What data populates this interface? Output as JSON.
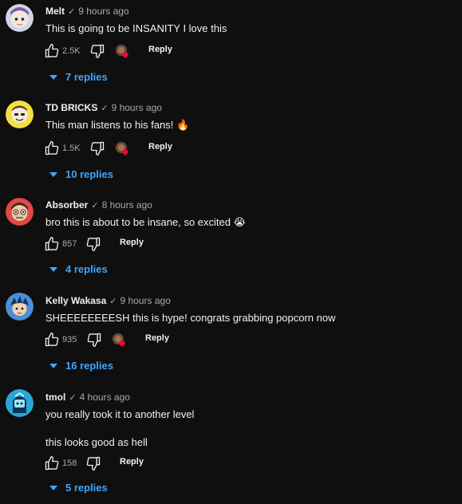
{
  "comments": [
    {
      "author": "Melt",
      "time": "9 hours ago",
      "text": [
        "This is going to be INSANITY I love this"
      ],
      "likes": "2.5K",
      "reply": "Reply",
      "replies": "7 replies",
      "creator_heart": true
    },
    {
      "author": "TD BRICKS",
      "time": "9 hours ago",
      "text": [
        "This man listens to his fans! 🔥"
      ],
      "likes": "1.5K",
      "reply": "Reply",
      "replies": "10 replies",
      "creator_heart": true
    },
    {
      "author": "Absorber",
      "time": "8 hours ago",
      "text": [
        "bro this is about to be insane, so excited 😭"
      ],
      "likes": "857",
      "reply": "Reply",
      "replies": "4 replies",
      "creator_heart": false
    },
    {
      "author": "Kelly Wakasa",
      "time": "9 hours ago",
      "text": [
        "SHEEEEEEEESH this is hype! congrats grabbing popcorn now"
      ],
      "likes": "935",
      "reply": "Reply",
      "replies": "16 replies",
      "creator_heart": true
    },
    {
      "author": "tmol",
      "time": "4 hours ago",
      "text": [
        "you really took it to another level",
        "this looks good as hell"
      ],
      "likes": "158",
      "reply": "Reply",
      "replies": "5 replies",
      "creator_heart": false
    }
  ],
  "icons": {
    "like": "thumbs-up-icon",
    "dislike": "thumbs-down-icon",
    "heart": "creator-heart-icon",
    "caret": "caret-down-icon",
    "verified": "check-icon"
  },
  "colors": {
    "background": "#0f0f0f",
    "text": "#f1f1f1",
    "secondary": "#aaaaaa",
    "link": "#3ea6ff",
    "heart": "#ff0033"
  }
}
